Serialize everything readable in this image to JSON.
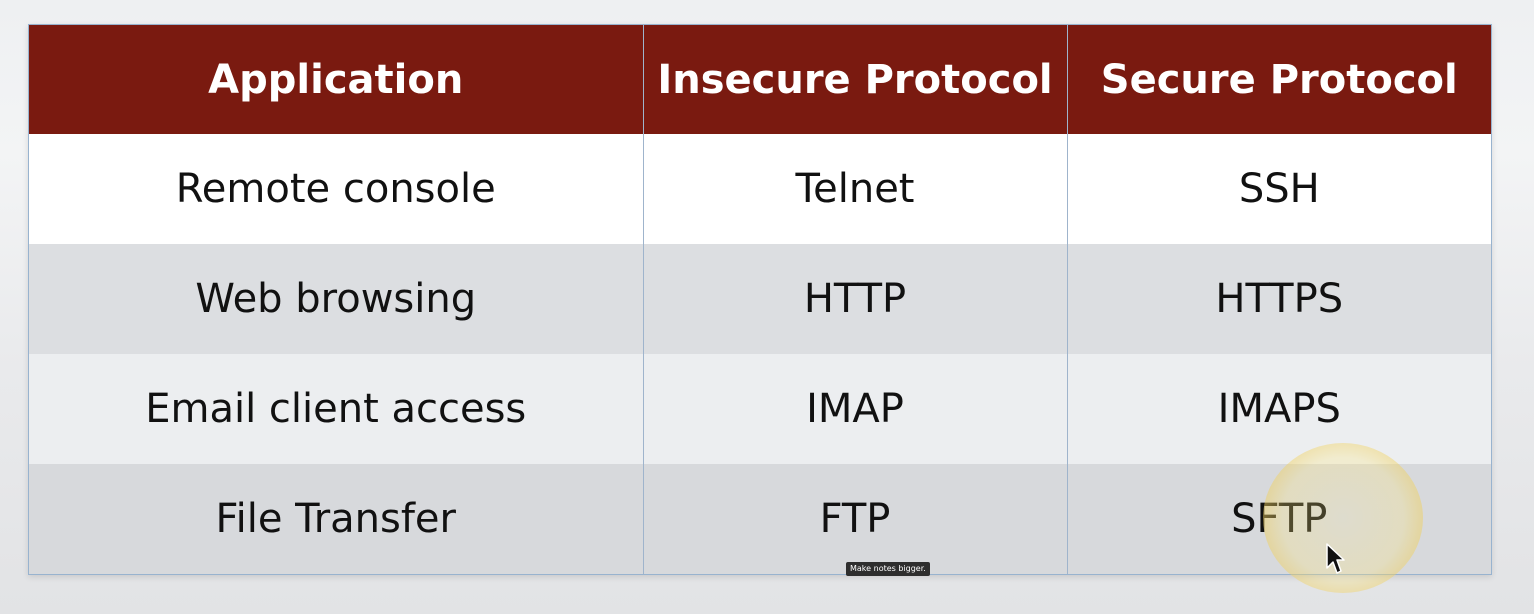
{
  "table": {
    "headers": [
      "Application",
      "Insecure Protocol",
      "Secure Protocol"
    ],
    "rows": [
      [
        "Remote console",
        "Telnet",
        "SSH"
      ],
      [
        "Web browsing",
        "HTTP",
        "HTTPS"
      ],
      [
        "Email client access",
        "IMAP",
        "IMAPS"
      ],
      [
        "File Transfer",
        "FTP",
        "SFTP"
      ]
    ]
  },
  "colors": {
    "header_bg": "#7a1a10",
    "header_text": "#ffffff",
    "row_light": "#ffffff",
    "row_shaded": "#dcdee1",
    "border": "#9fb4cc"
  },
  "tooltip": {
    "text": "Make notes bigger."
  },
  "icons": {
    "cursor": "mouse-pointer-icon",
    "highlight": "cursor-highlight-ring"
  }
}
